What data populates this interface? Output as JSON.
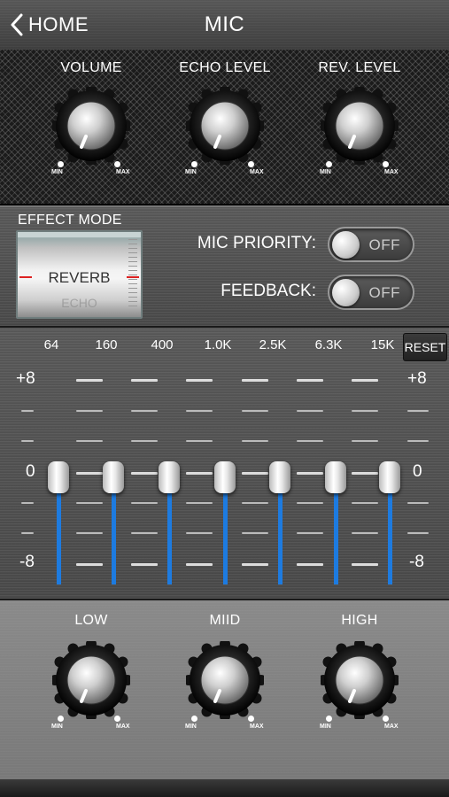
{
  "header": {
    "back_label": "HOME",
    "title": "MIC"
  },
  "top_knobs": [
    {
      "label": "VOLUME",
      "min": "MIN",
      "max": "MAX"
    },
    {
      "label": "ECHO LEVEL",
      "min": "MIN",
      "max": "MAX"
    },
    {
      "label": "REV. LEVEL",
      "min": "MIN",
      "max": "MAX"
    }
  ],
  "effect": {
    "title": "EFFECT MODE",
    "selected": "REVERB",
    "next_option": "ECHO",
    "mic_priority": {
      "label": "MIC PRIORITY:",
      "state": "OFF"
    },
    "feedback": {
      "label": "FEEDBACK:",
      "state": "OFF"
    }
  },
  "eq": {
    "bands": [
      "64",
      "160",
      "400",
      "1.0K",
      "2.5K",
      "6.3K",
      "15K"
    ],
    "values": [
      0,
      0,
      0,
      0,
      0,
      0,
      0
    ],
    "reset_label": "RESET",
    "scale_top": "+8",
    "scale_mid": "0",
    "scale_bottom": "-8",
    "accent_color": "#1d7be0"
  },
  "tone_knobs": [
    {
      "label": "LOW",
      "min": "MIN",
      "max": "MAX"
    },
    {
      "label": "MIID",
      "min": "MIN",
      "max": "MAX"
    },
    {
      "label": "HIGH",
      "min": "MIN",
      "max": "MAX"
    }
  ]
}
